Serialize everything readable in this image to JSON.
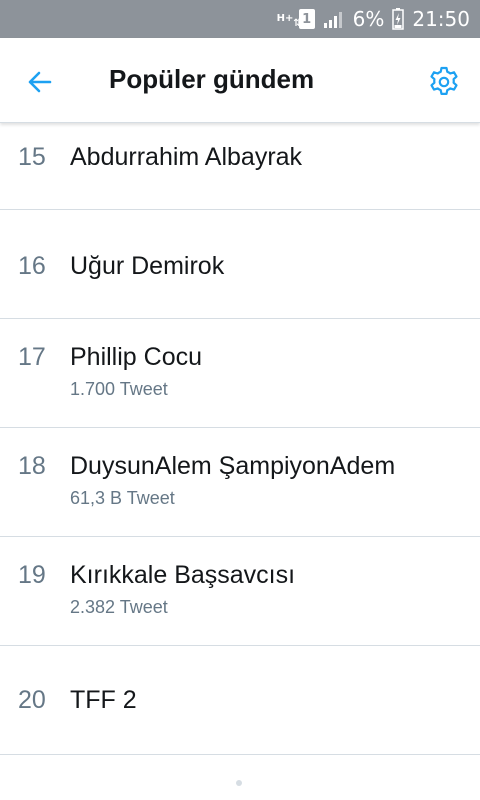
{
  "status_bar": {
    "network": "H+",
    "sim": "1",
    "battery_percent": "6%",
    "time": "21:50",
    "icons": [
      "network-type-icon",
      "sim-icon",
      "signal-icon",
      "battery-charging-icon"
    ]
  },
  "app_bar": {
    "title": "Popüler gündem",
    "back_icon": "arrow-left-icon",
    "settings_icon": "gear-icon",
    "accent_color": "#1da1f2"
  },
  "trends": [
    {
      "rank": "15",
      "name": "Abdurrahim Albayrak",
      "count": ""
    },
    {
      "rank": "16",
      "name": "Uğur Demirok",
      "count": ""
    },
    {
      "rank": "17",
      "name": "Phillip Cocu",
      "count": "1.700 Tweet"
    },
    {
      "rank": "18",
      "name": "DuysunAlem ŞampiyonAdem",
      "count": "61,3 B Tweet"
    },
    {
      "rank": "19",
      "name": "Kırıkkale Başsavcısı",
      "count": "2.382 Tweet"
    },
    {
      "rank": "20",
      "name": "TFF 2",
      "count": ""
    }
  ]
}
